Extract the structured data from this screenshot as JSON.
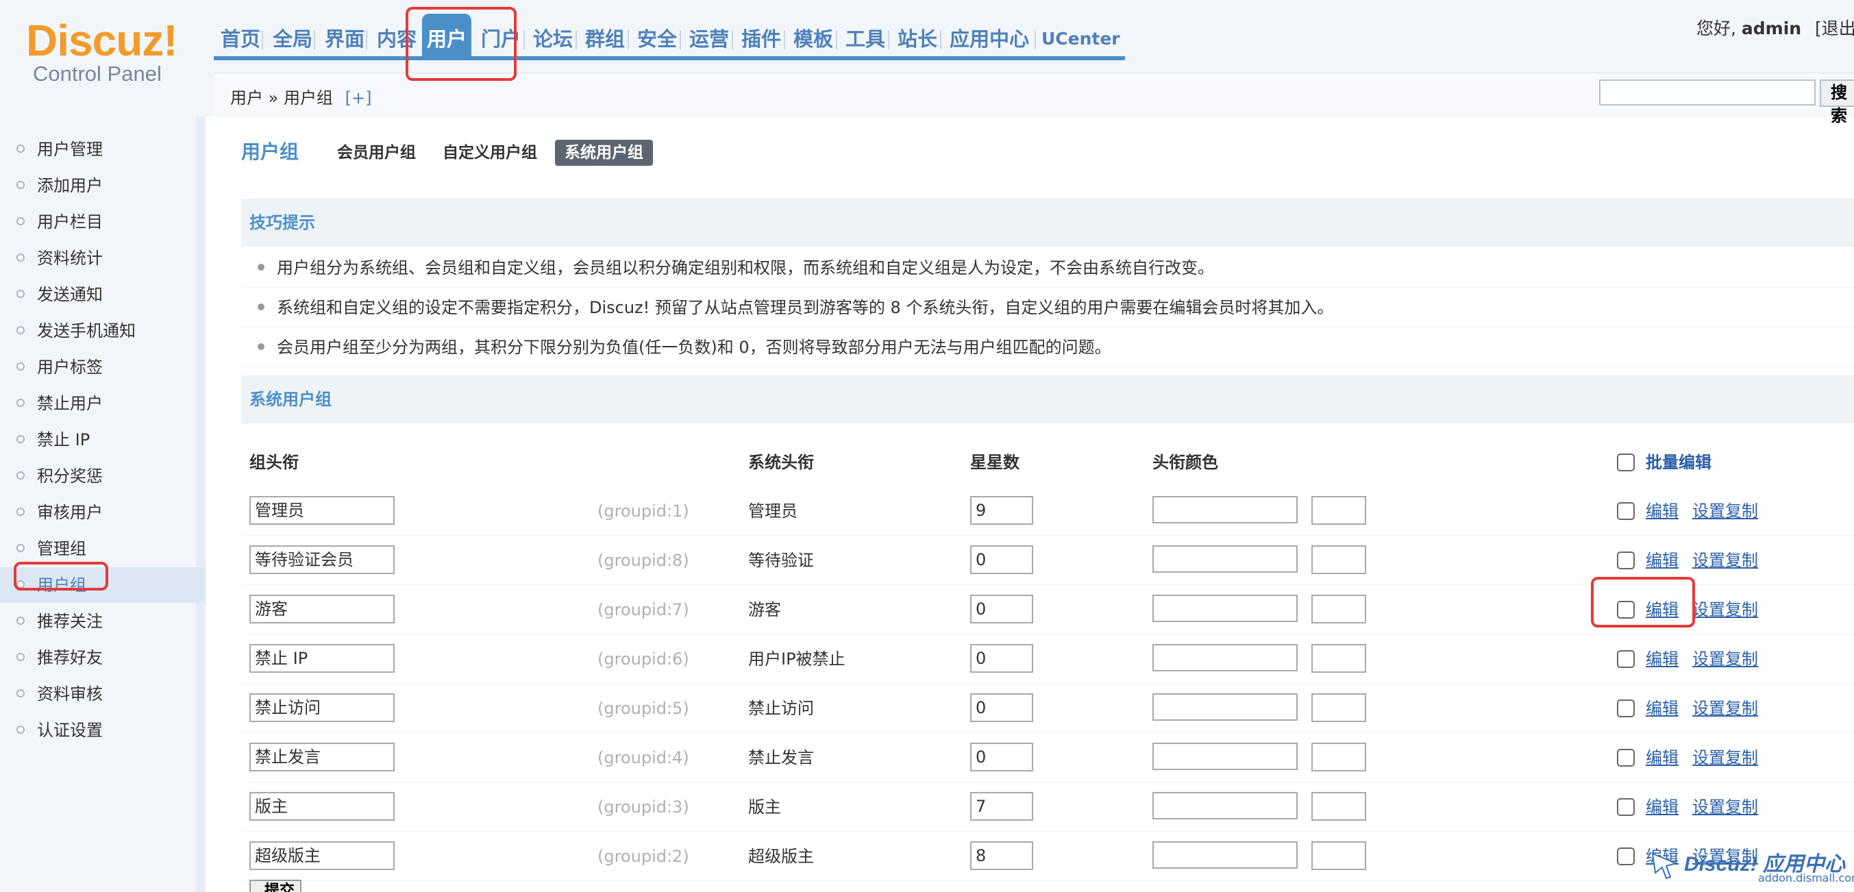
{
  "logo": {
    "main": "Discuz!",
    "sub": "Control Panel"
  },
  "nav": {
    "items": [
      "首页",
      "全局",
      "界面",
      "内容",
      "用户",
      "门户",
      "论坛",
      "群组",
      "安全",
      "运营",
      "插件",
      "模板",
      "工具",
      "站长",
      "应用中心",
      "UCenter"
    ],
    "active": "用户"
  },
  "user_info": {
    "greeting": "您好,",
    "name": "admin",
    "logout": "[退出]"
  },
  "breadcrumb": {
    "path": "用户 » 用户组",
    "add": "[+]"
  },
  "search": {
    "button": "搜索",
    "value": ""
  },
  "sidebar": {
    "items": [
      {
        "label": "用户管理"
      },
      {
        "label": "添加用户"
      },
      {
        "label": "用户栏目"
      },
      {
        "label": "资料统计"
      },
      {
        "label": "发送通知"
      },
      {
        "label": "发送手机通知"
      },
      {
        "label": "用户标签"
      },
      {
        "label": "禁止用户"
      },
      {
        "label": "禁止 IP"
      },
      {
        "label": "积分奖惩"
      },
      {
        "label": "审核用户"
      },
      {
        "label": "管理组"
      },
      {
        "label": "用户组"
      },
      {
        "label": "推荐关注"
      },
      {
        "label": "推荐好友"
      },
      {
        "label": "资料审核"
      },
      {
        "label": "认证设置"
      }
    ],
    "active": "用户组"
  },
  "main": {
    "title": "用户组",
    "tabs": [
      "会员用户组",
      "自定义用户组",
      "系统用户组"
    ],
    "active_tab": "系统用户组",
    "tips": {
      "heading": "技巧提示",
      "items": [
        "用户组分为系统组、会员组和自定义组，会员组以积分确定组别和权限，而系统组和自定义组是人为设定，不会由系统自行改变。",
        "系统组和自定义组的设定不需要指定积分，Discuz! 预留了从站点管理员到游客等的 8 个系统头衔，自定义组的用户需要在编辑会员时将其加入。",
        "会员用户组至少分为两组，其积分下限分别为负值(任一负数)和 0，否则将导致部分用户无法与用户组匹配的问题。"
      ]
    },
    "table": {
      "heading": "系统用户组",
      "columns": {
        "group_title": "组头衔",
        "system_title": "系统头衔",
        "stars": "星星数",
        "title_color": "头衔颜色",
        "batch_edit": "批量编辑"
      },
      "rows": [
        {
          "name": "管理员",
          "gid": "(groupid:1)",
          "system": "管理员",
          "stars": "9",
          "edit": "编辑",
          "copy": "设置复制"
        },
        {
          "name": "等待验证会员",
          "gid": "(groupid:8)",
          "system": "等待验证",
          "stars": "0",
          "edit": "编辑",
          "copy": "设置复制"
        },
        {
          "name": "游客",
          "gid": "(groupid:7)",
          "system": "游客",
          "stars": "0",
          "edit": "编辑",
          "copy": "设置复制"
        },
        {
          "name": "禁止 IP",
          "gid": "(groupid:6)",
          "system": "用户IP被禁止",
          "stars": "0",
          "edit": "编辑",
          "copy": "设置复制"
        },
        {
          "name": "禁止访问",
          "gid": "(groupid:5)",
          "system": "禁止访问",
          "stars": "0",
          "edit": "编辑",
          "copy": "设置复制"
        },
        {
          "name": "禁止发言",
          "gid": "(groupid:4)",
          "system": "禁止发言",
          "stars": "0",
          "edit": "编辑",
          "copy": "设置复制"
        },
        {
          "name": "版主",
          "gid": "(groupid:3)",
          "system": "版主",
          "stars": "7",
          "edit": "编辑",
          "copy": "设置复制"
        },
        {
          "name": "超级版主",
          "gid": "(groupid:2)",
          "system": "超级版主",
          "stars": "8",
          "edit": "编辑",
          "copy": "设置复制"
        }
      ],
      "submit": "提交"
    }
  },
  "watermark": {
    "text": "Discuz! 应用中心",
    "url": "addon.dismall.com"
  },
  "colors": {
    "accent": "#4b8fc9",
    "link": "#2a5fa8",
    "highlight": "#e33b3b",
    "logo": "#f29b2b"
  }
}
